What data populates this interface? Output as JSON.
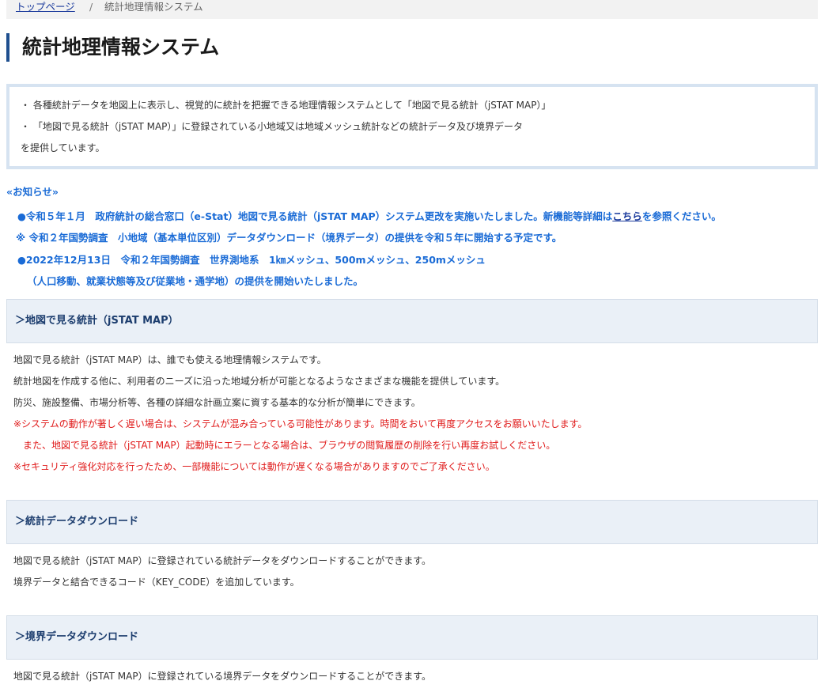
{
  "breadcrumb": {
    "home": "トップページ",
    "separator": "/",
    "current": "統計地理情報システム"
  },
  "page_title": "統計地理情報システム",
  "intro": {
    "lines": [
      "・ 各種統計データを地図上に表示し、視覚的に統計を把握できる地理情報システムとして「地図で見る統計（jSTAT MAP）」",
      "・ 「地図で見る統計（jSTAT MAP）」に登録されている小地域又は地域メッシュ統計などの統計データ及び境界データ",
      "を提供しています。"
    ]
  },
  "notice": {
    "heading": "«お知らせ»",
    "item1_before": "●令和５年１月　政府統計の総合窓口（e-Stat）地図で見る統計（jSTAT MAP）システム更改を実施いたしました。新機能等詳細は",
    "item1_link": "こちら",
    "item1_after": "を参照ください。",
    "item2": "※ 令和２年国勢調査　小地域（基本単位区別）データダウンロード（境界データ）の提供を令和５年に開始する予定です。",
    "item3_line1": "●2022年12月13日　令和２年国勢調査　世界測地系　1㎞メッシュ、500mメッシュ、250mメッシュ",
    "item3_line2": "（人口移動、就業状態等及び従業地・通学地）の提供を開始いたしました。"
  },
  "sections": [
    {
      "title": "＞地図で見る統計（jSTAT MAP）",
      "lines": [
        "地図で見る統計（jSTAT MAP）は、誰でも使える地理情報システムです。",
        "統計地図を作成する他に、利用者のニーズに沿った地域分析が可能となるようなさまざまな機能を提供しています。",
        "防災、施設整備、市場分析等、各種の詳細な計画立案に資する基本的な分析が簡単にできます。"
      ],
      "warnings": [
        "※システムの動作が著しく遅い場合は、システムが混み合っている可能性があります。時間をおいて再度アクセスをお願いいたします。",
        "　また、地図で見る統計（jSTAT MAP）起動時にエラーとなる場合は、ブラウザの閲覧履歴の削除を行い再度お試しください。",
        "※セキュリティ強化対応を行ったため、一部機能については動作が遅くなる場合がありますのでご了承ください。"
      ]
    },
    {
      "title": "＞統計データダウンロード",
      "lines": [
        "地図で見る統計（jSTAT MAP）に登録されている統計データをダウンロードすることができます。",
        "境界データと結合できるコード（KEY_CODE）を追加しています。"
      ]
    },
    {
      "title": "＞境界データダウンロード",
      "lines": [
        "地図で見る統計（jSTAT MAP）に登録されている境界データをダウンロードすることができます。"
      ]
    }
  ]
}
